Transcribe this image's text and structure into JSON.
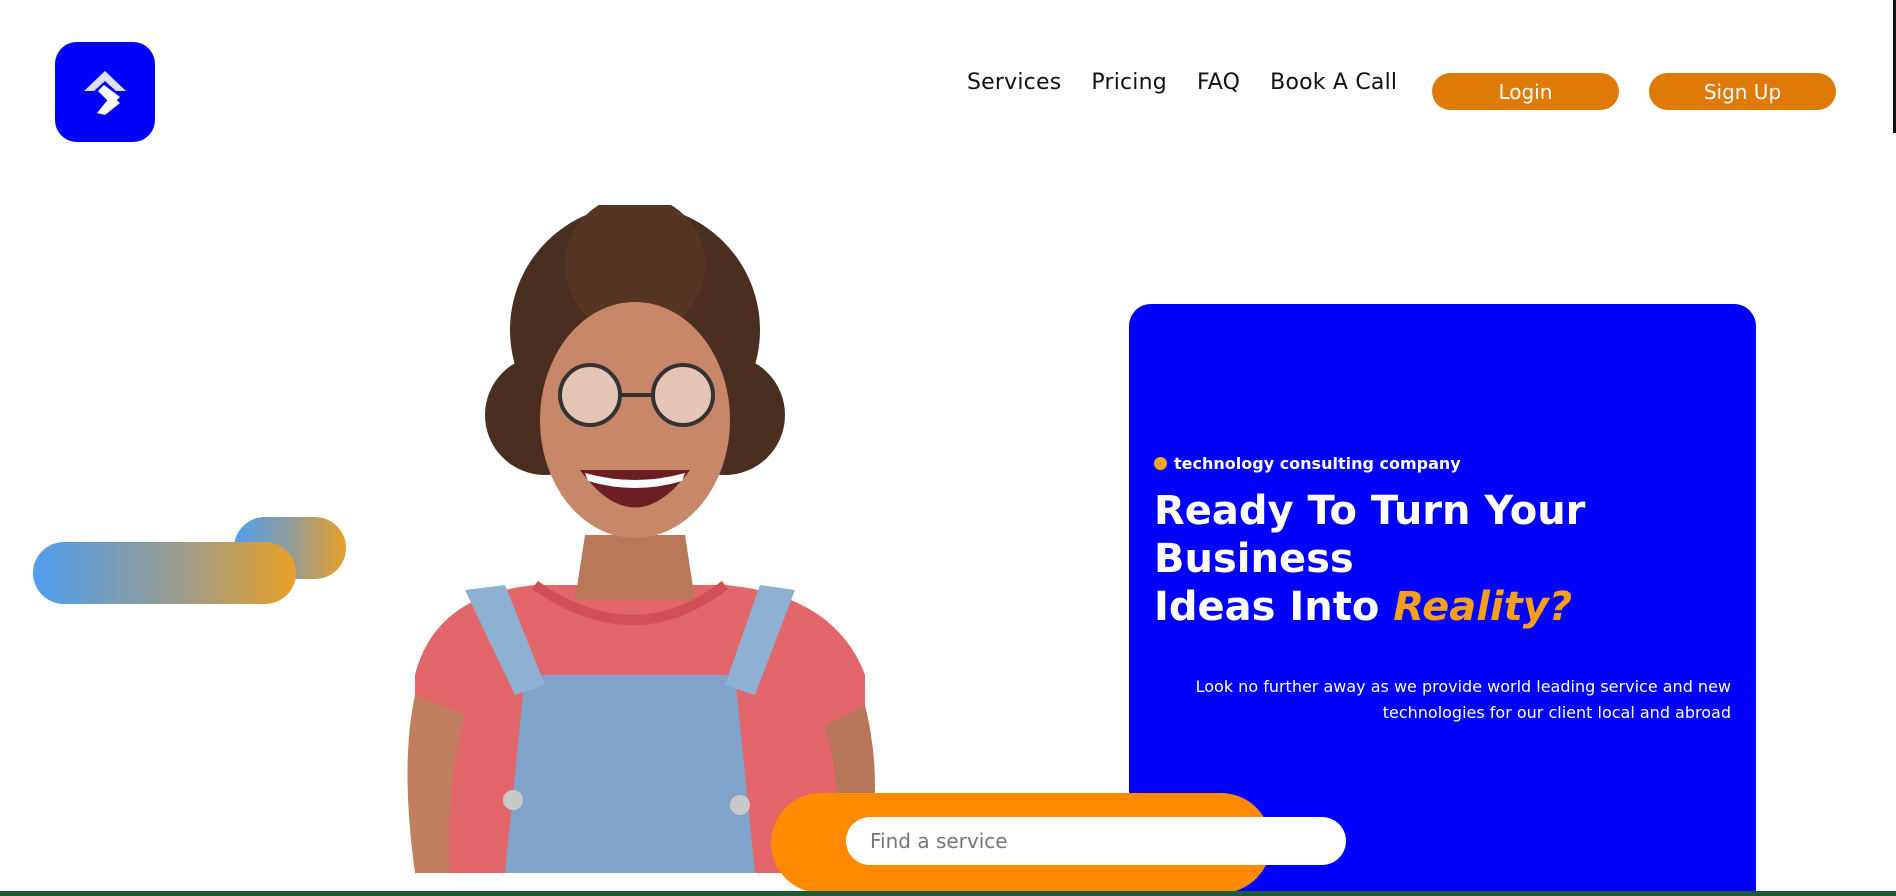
{
  "header": {
    "logo_icon": "arrow-logo-icon",
    "nav": [
      {
        "label": "Services"
      },
      {
        "label": "Pricing"
      },
      {
        "label": "FAQ"
      },
      {
        "label": "Book A Call"
      }
    ],
    "login_label": "Login",
    "signup_label": "Sign Up"
  },
  "hero": {
    "tagline": "technology consulting company",
    "headline_line1": "Ready To Turn Your",
    "headline_line2": "Business",
    "headline_line3": "Ideas Into ",
    "headline_accent": "Reality?",
    "subtext": "Look no further away as we provide world leading service and new technologies for our client local and abroad"
  },
  "search": {
    "placeholder": "Find a service",
    "value": ""
  },
  "colors": {
    "brand_blue": "#0000ff",
    "accent_orange": "#e07a06",
    "search_band": "#ff8a00",
    "headline_accent": "#f59f1b"
  }
}
